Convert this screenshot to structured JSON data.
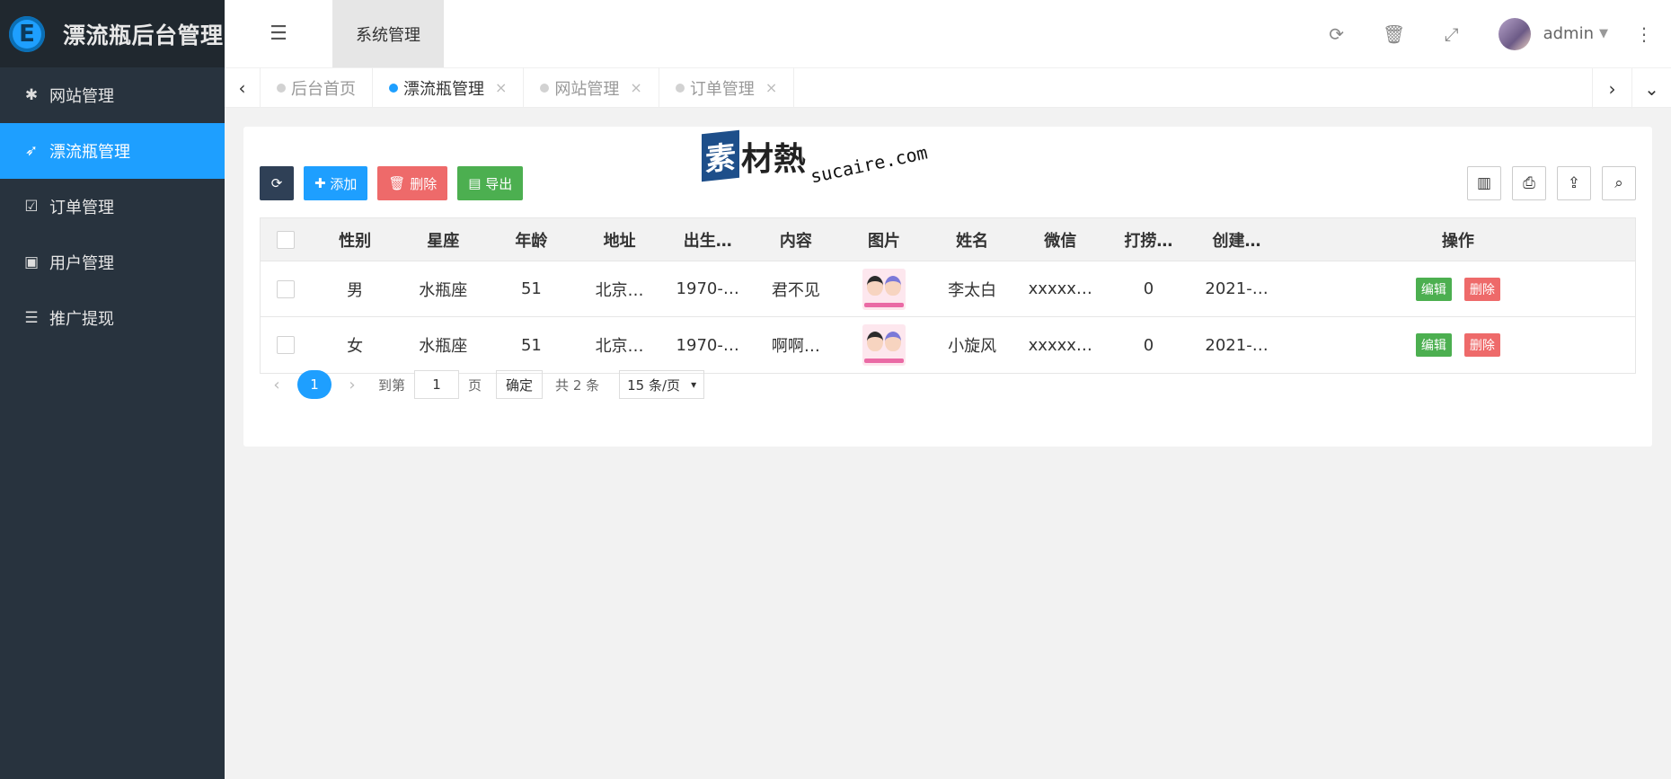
{
  "app": {
    "logo_letter": "E",
    "title": "漂流瓶后台管理"
  },
  "sidebar": {
    "items": [
      {
        "label": "网站管理",
        "icon": "asterisk-icon",
        "active": false
      },
      {
        "label": "漂流瓶管理",
        "icon": "rocket-icon",
        "active": true
      },
      {
        "label": "订单管理",
        "icon": "calendar-check-icon",
        "active": false
      },
      {
        "label": "用户管理",
        "icon": "user-card-icon",
        "active": false
      },
      {
        "label": "推广提现",
        "icon": "list-icon",
        "active": false
      }
    ]
  },
  "header": {
    "system_tab": "系统管理",
    "user": "admin"
  },
  "tabs": [
    {
      "label": "后台首页",
      "closable": false,
      "active": false
    },
    {
      "label": "漂流瓶管理",
      "closable": true,
      "active": true
    },
    {
      "label": "网站管理",
      "closable": true,
      "active": false
    },
    {
      "label": "订单管理",
      "closable": true,
      "active": false
    }
  ],
  "toolbar": {
    "add_label": "添加",
    "delete_label": "删除",
    "export_label": "导出"
  },
  "watermark": {
    "box": "素",
    "text": "材熱",
    "url": "sucaire.com"
  },
  "table": {
    "columns": [
      "性别",
      "星座",
      "年龄",
      "地址",
      "出生…",
      "内容",
      "图片",
      "姓名",
      "微信",
      "打捞…",
      "创建…",
      "操作"
    ],
    "rows": [
      {
        "sex": "男",
        "star": "水瓶座",
        "age": "51",
        "addr": "北京…",
        "birth": "1970-…",
        "content": "君不见",
        "name": "李太白",
        "wx": "xxxxx…",
        "fish": "0",
        "created": "2021-…"
      },
      {
        "sex": "女",
        "star": "水瓶座",
        "age": "51",
        "addr": "北京…",
        "birth": "1970-…",
        "content": "啊啊…",
        "name": "小旋风",
        "wx": "xxxxx…",
        "fish": "0",
        "created": "2021-…"
      }
    ],
    "edit_label": "编辑",
    "delete_label": "删除"
  },
  "pager": {
    "current": "1",
    "goto_label": "到第",
    "goto_value": "1",
    "page_label": "页",
    "ok_label": "确定",
    "total_label": "共 2 条",
    "per_page": "15 条/页"
  },
  "colors": {
    "sidebar": "#28333e",
    "accent": "#1e9fff",
    "danger": "#ee6a6a",
    "success": "#4caf50"
  }
}
